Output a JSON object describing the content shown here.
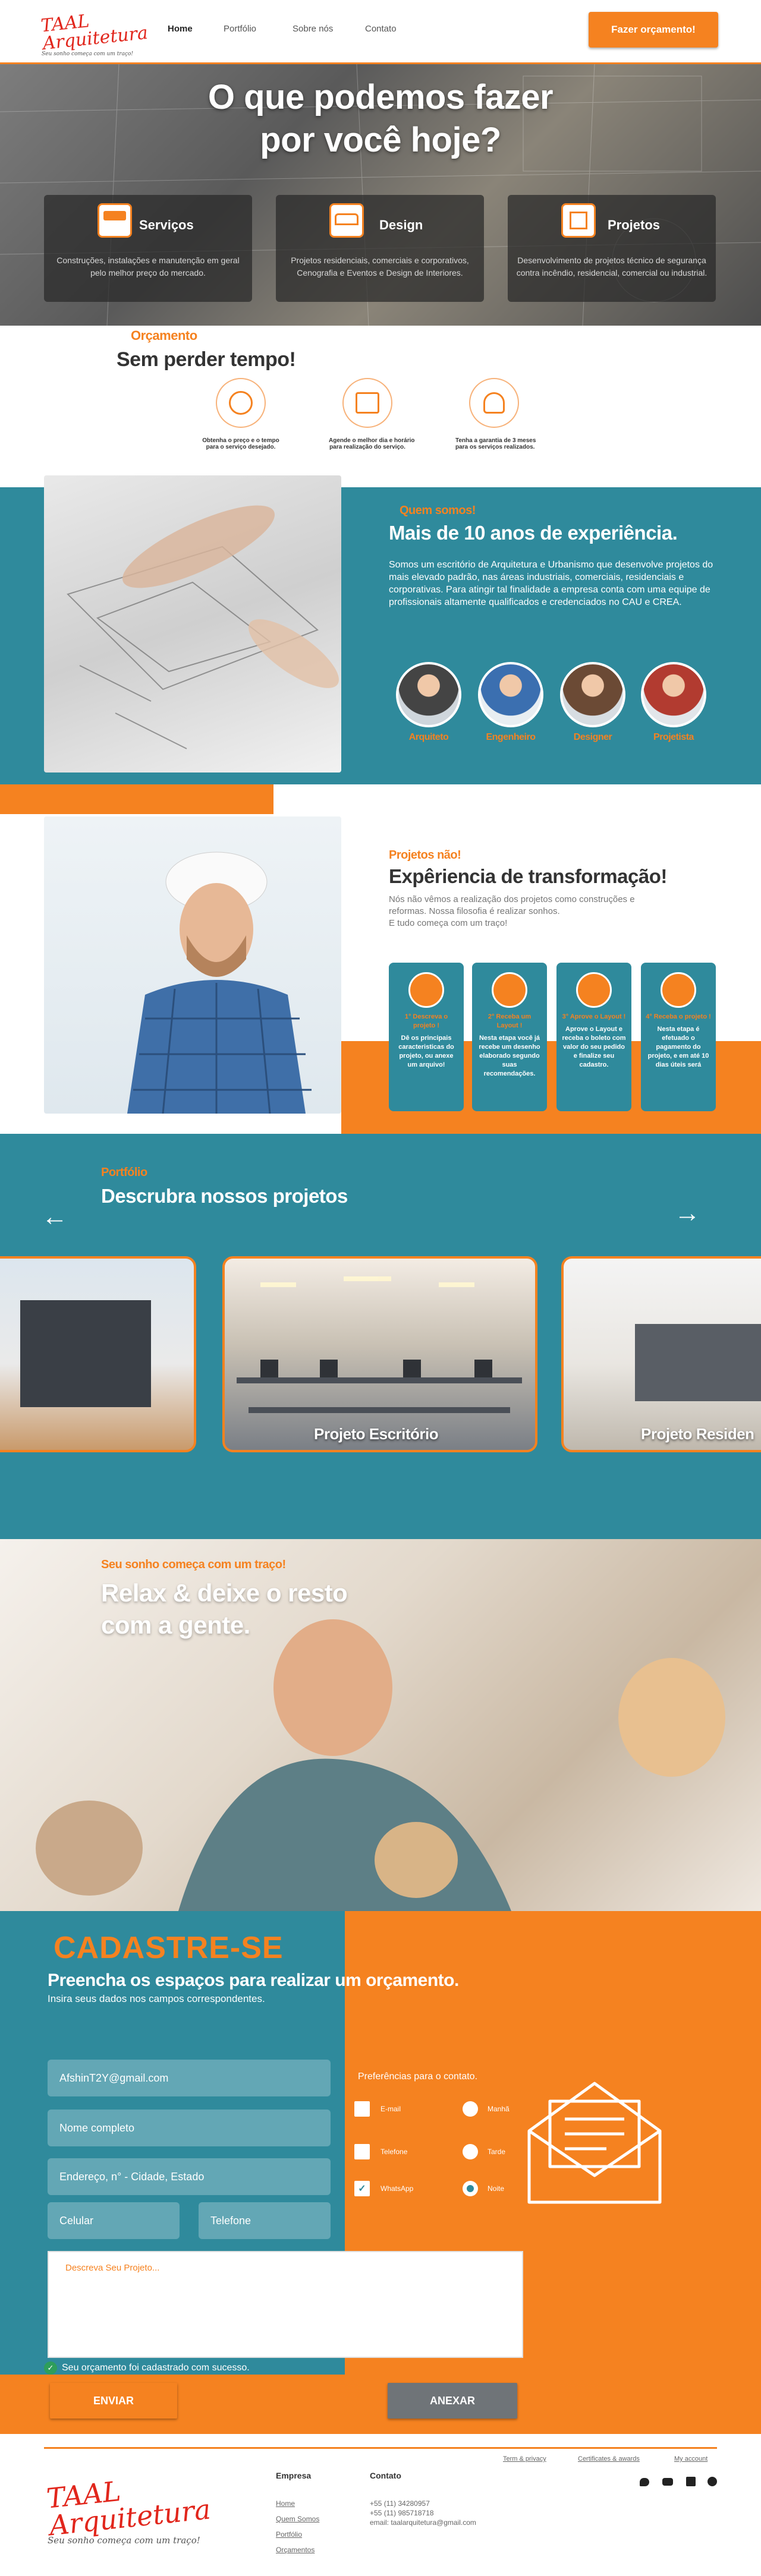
{
  "header": {
    "logo_title": "TAAL Arquitetura",
    "logo_subtitle": "Seu sonho começa com um traço!",
    "nav": [
      "Home",
      "Portfólio",
      "Sobre nós",
      "Contato"
    ],
    "cta": "Fazer orçamento!"
  },
  "hero": {
    "title_line1": "O que podemos fazer",
    "title_line2": "por você hoje?",
    "cards": [
      {
        "icon": "paint-roller-icon",
        "title": "Serviços",
        "text": "Construções, instalações e manutenção em geral pelo melhor preço do mercado."
      },
      {
        "icon": "sofa-icon",
        "title": "Design",
        "text": "Projetos residenciais, comerciais e corporativos, Cenografia e Eventos e  Design de Interiores."
      },
      {
        "icon": "blueprint-icon",
        "title": "Projetos",
        "text": "Desenvolvimento de projetos técnico de segurança contra incêndio, residencial, comercial ou industrial."
      }
    ]
  },
  "budget": {
    "kicker": "Orçamento",
    "title": "Sem perder tempo!",
    "steps": [
      {
        "icon": "money-icon",
        "line1": "Obtenha o preço e o tempo",
        "line2": "para o serviço desejado."
      },
      {
        "icon": "calendar-icon",
        "line1": "Agende o melhor dia e horário",
        "line2": "para realização do serviço."
      },
      {
        "icon": "guarantee-icon",
        "line1": "Tenha a garantia de 3 meses",
        "line2": "para os serviços realizados."
      }
    ]
  },
  "about": {
    "kicker": "Quem somos!",
    "title": "Mais de 10 anos de experiência.",
    "text": "Somos um escritório de Arquitetura e Urbanismo que desenvolve projetos do mais elevado padrão, nas áreas industriais, comerciais, residenciais e corporativas. Para atingir tal finalidade a empresa conta com uma equipe de profissionais altamente qualificados e credenciados no CAU e CREA.",
    "team": [
      "Arquiteto",
      "Engenheiro",
      "Designer",
      "Projetista"
    ]
  },
  "projects": {
    "kicker": "Projetos não!",
    "title": "Expêriencia de transformação!",
    "text": "Nós não vêmos a realização dos projetos como construções e reformas. Nossa filosofia é realizar sonhos.",
    "text2": "E tudo começa com um traço!",
    "steps": [
      {
        "icon": "lightbulb-icon",
        "title": "1° Descreva o projeto !",
        "text": "Dê os principais caracteristicas do projeto, ou anexe um arquivo!"
      },
      {
        "icon": "layout-icon",
        "title": "2° Receba um Layout !",
        "text": "Nesta etapa você já recebe um desenho elaborado segundo suas recomendações."
      },
      {
        "icon": "thumbs-up-icon",
        "title": "3° Aprove o Layout !",
        "text": "Aprove o Layout e receba o boleto com valor do seu pedido e finalize seu cadastro."
      },
      {
        "icon": "gift-icon",
        "title": "4° Receba o projeto !",
        "text": "Nesta etapa é efetuado o pagamento do projeto, e em até 10 dias úteis será"
      }
    ]
  },
  "portfolio": {
    "kicker": "Portfólio",
    "title": "Descrubra nossos projetos",
    "items": [
      "Projeto Escritório",
      "Projeto Residen"
    ]
  },
  "dream": {
    "kicker": "Seu sonho começa com um traço!",
    "title_line1": "Relax & deixe o resto",
    "title_line2": "com a gente."
  },
  "signup": {
    "title": "CADASTRE-SE",
    "subtitle": "Preencha os espaços para realizar um orçamento.",
    "hint": "Insira seus dados nos campos correspondentes.",
    "email_value": "AfshinT2Y@gmail.com",
    "name_placeholder": "Nome completo",
    "address_placeholder": "Endereço, n° - Cidade, Estado",
    "phone_placeholder": "Celular",
    "tel_placeholder": "Telefone",
    "pref_label": "Preferências  para o contato.",
    "pref_contacts": [
      "E-mail",
      "Telefone",
      "WhatsApp"
    ],
    "pref_times": [
      "Manhã",
      "Tarde",
      "Noite"
    ],
    "desc_placeholder": "Descreva Seu Projeto...",
    "success": "Seu orçamento foi cadastrado com sucesso.",
    "send": "ENVIAR",
    "attach": "ANEXAR"
  },
  "footer": {
    "company_heading": "Empresa",
    "company_links": [
      "Home",
      "Quem Somos",
      "Portfólio",
      "Orçamentos"
    ],
    "contact_heading": "Contato",
    "contacts": [
      "+55 (11) 34280957",
      "+55 (11) 985718718",
      "email: taalarquitetura@gmail.com"
    ],
    "top_links": [
      "Term & privacy",
      "Certificates & awards",
      "My account"
    ],
    "social": [
      "twitter-icon",
      "youtube-icon",
      "linkedin-icon",
      "pinterest-icon"
    ]
  },
  "colors": {
    "accent": "#f58220",
    "teal": "#2f8a9c",
    "logo_red": "#e1261c"
  }
}
